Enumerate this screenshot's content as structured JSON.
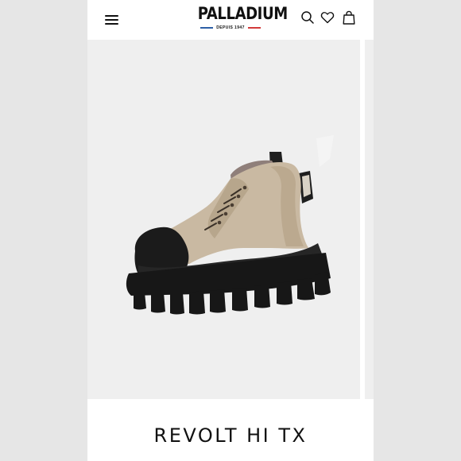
{
  "header": {
    "menu_icon": "hamburger-menu-icon",
    "logo": {
      "wordmark": "PALLADIUM",
      "tagline": "DEPUIS 1947",
      "colors": {
        "left_bar": "#2d5fa6",
        "right_bar": "#d23a3a"
      }
    },
    "icons": [
      "search-icon",
      "heart-icon",
      "shopping-bag-icon"
    ]
  },
  "product": {
    "name": "REVOLT HI TX",
    "image_alt": "boot"
  },
  "colors": {
    "background": "#efefef",
    "text": "#111111",
    "canvas": "#c9b9a2",
    "sole": "#1b1b1b"
  }
}
